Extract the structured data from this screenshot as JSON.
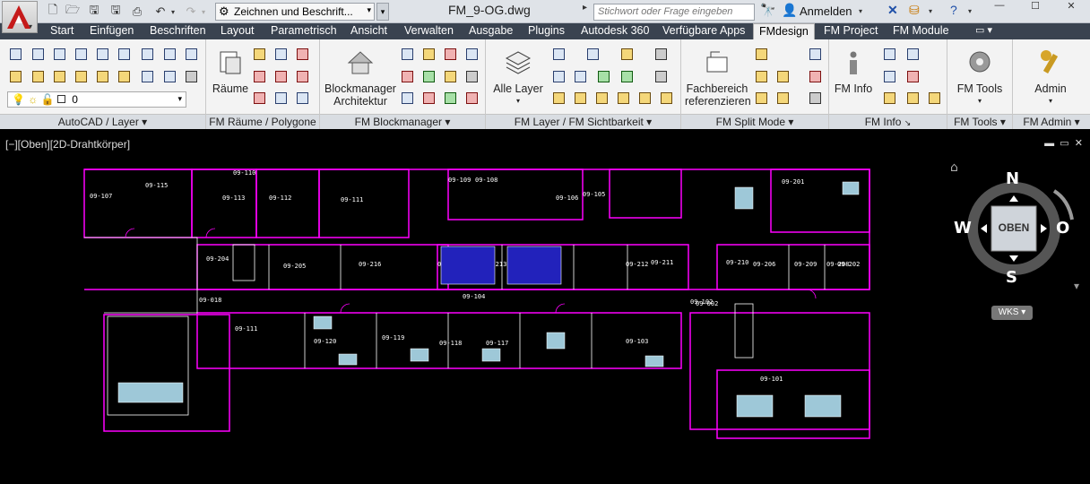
{
  "title_bar": {
    "workspace": "Zeichnen und Beschrift...",
    "document_title": "FM_9-OG.dwg",
    "search_placeholder": "Stichwort oder Frage eingeben",
    "sign_in": "Anmelden"
  },
  "tabs": [
    {
      "label": "Start"
    },
    {
      "label": "Einfügen"
    },
    {
      "label": "Beschriften"
    },
    {
      "label": "Layout"
    },
    {
      "label": "Parametrisch"
    },
    {
      "label": "Ansicht"
    },
    {
      "label": "Verwalten"
    },
    {
      "label": "Ausgabe"
    },
    {
      "label": "Plugins"
    },
    {
      "label": "Autodesk 360"
    },
    {
      "label": "Verfügbare Apps"
    },
    {
      "label": "FMdesign"
    },
    {
      "label": "FM Project"
    },
    {
      "label": "FM Module"
    }
  ],
  "active_tab": "FMdesign",
  "ribbon": {
    "layer_panel": {
      "label": "AutoCAD / Layer",
      "layer_value": "0"
    },
    "raeume_panel": {
      "label": "FM Räume / Polygone",
      "button": "Räume"
    },
    "block_panel": {
      "label": "FM Blockmanager",
      "button_line1": "Blockmanager",
      "button_line2": "Architektur"
    },
    "layer_vis_panel": {
      "label": "FM Layer / FM Sichtbarkeit",
      "button": "Alle Layer"
    },
    "split_panel": {
      "label": "FM Split Mode",
      "button_line1": "Fachbereich",
      "button_line2": "referenzieren"
    },
    "info_panel": {
      "label": "FM Info",
      "button": "FM Info"
    },
    "tools_panel": {
      "label": "FM Tools",
      "button": "FM Tools"
    },
    "admin_panel": {
      "label": "FM Admin",
      "button": "Admin"
    }
  },
  "viewport": {
    "label": "[−][Oben][2D-Drahtkörper]",
    "viewcube": {
      "face": "OBEN",
      "north": "N",
      "south": "S",
      "west": "W",
      "east": "O",
      "ucs": "WKS"
    },
    "rooms": [
      "09-107",
      "09-115",
      "09-113",
      "09-112",
      "09-111",
      "09-110",
      "09-109",
      "09-108",
      "09-106",
      "09-105",
      "09-204",
      "09-205",
      "09-216",
      "09-214",
      "09-213",
      "09-212",
      "09-211",
      "09-210",
      "09-209",
      "09-208",
      "09-206",
      "09-201",
      "09-202",
      "09-018",
      "09-111",
      "09-120",
      "09-119",
      "09-118",
      "09-117",
      "09-104",
      "09-103",
      "09-102",
      "09-101",
      "09-002"
    ]
  },
  "colors": {
    "wall": "#ff00ff",
    "line": "#ffffff",
    "furniture": "#9ec8d8",
    "background": "#000000",
    "tab_bar": "#3a4350"
  }
}
